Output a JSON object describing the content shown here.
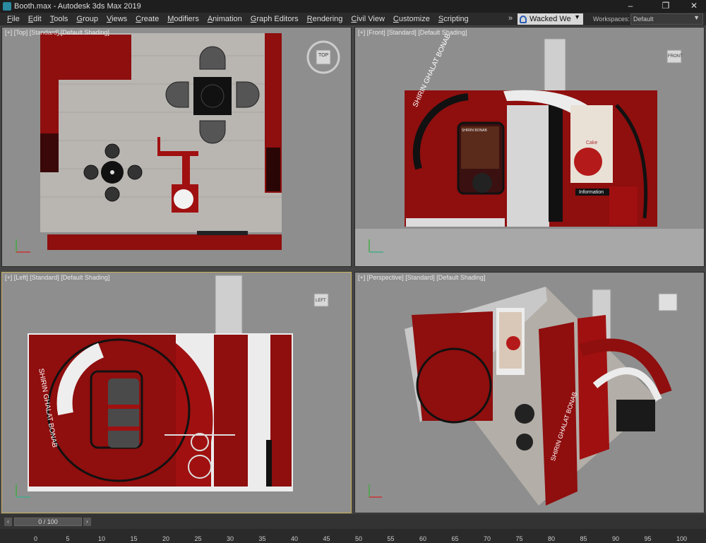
{
  "window": {
    "title": "Booth.max - Autodesk 3ds Max 2019",
    "min": "–",
    "max": "❐",
    "close": "✕"
  },
  "menu": [
    "File",
    "Edit",
    "Tools",
    "Group",
    "Views",
    "Create",
    "Modifiers",
    "Animation",
    "Graph Editors",
    "Rendering",
    "Civil View",
    "Customize",
    "Scripting"
  ],
  "toolbar": {
    "overflow": "»",
    "user": "Wacked We",
    "workspaces_label": "Workspaces:",
    "workspace": "Default"
  },
  "viewports": {
    "top": {
      "label": "[+] [Top] [Standard] [Default Shading]",
      "cube": "TOP"
    },
    "front": {
      "label": "[+] [Front] [Standard] [Default Shading]",
      "cube": "FRONT"
    },
    "left": {
      "label": "[+] [Left] [Standard] [Default Shading]",
      "cube": "LEFT"
    },
    "persp": {
      "label": "[+] [Perspective] [Standard] [Default Shading]"
    }
  },
  "booth": {
    "brand": "SHIRIN GHALAT BONAB",
    "info": "Information",
    "poster": "Cake",
    "poster_top": "SHIRIN BONAB"
  },
  "timeline": {
    "frame": "0 / 100",
    "ticks": [
      "0",
      "5",
      "10",
      "15",
      "20",
      "25",
      "30",
      "35",
      "40",
      "45",
      "50",
      "55",
      "60",
      "65",
      "70",
      "75",
      "80",
      "85",
      "90",
      "95",
      "100"
    ]
  },
  "colors": {
    "booth_red": "#8f0e0e",
    "viewport_bg": "#8e8e8e",
    "active_border": "#c8b15a"
  }
}
